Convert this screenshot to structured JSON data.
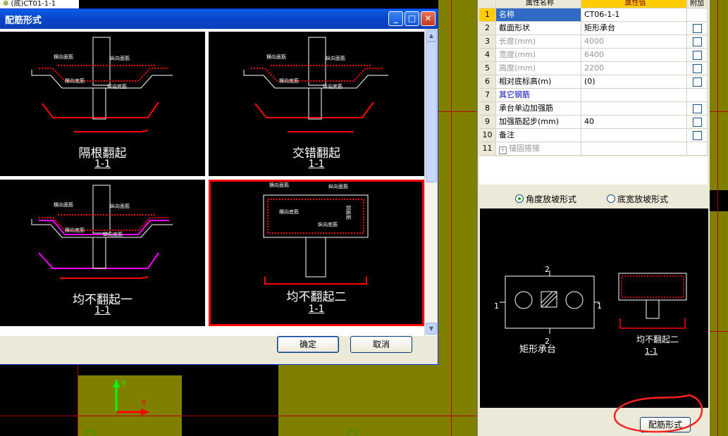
{
  "tree": {
    "item": "(底)CT01-1-1"
  },
  "dialog": {
    "title": "配筋形式",
    "ok_label": "确定",
    "cancel_label": "取消",
    "tiles": [
      {
        "label": "隔根翻起",
        "section": "1-1"
      },
      {
        "label": "交错翻起",
        "section": "1-1"
      },
      {
        "label": "均不翻起一",
        "section": "1-1"
      },
      {
        "label": "均不翻起二",
        "section": "1-1"
      }
    ],
    "annotations": {
      "top_transverse": "横向面筋",
      "top_longitudinal": "纵向面筋",
      "bottom_transverse": "横向底筋",
      "bottom_longitudinal": "纵向底筋",
      "side": "侧面筋"
    }
  },
  "properties": {
    "header": {
      "name": "属性名称",
      "value": "属性值",
      "attach": "附加"
    },
    "rows": [
      {
        "no": "1",
        "name": "名称",
        "value": "CT06-1-1"
      },
      {
        "no": "2",
        "name": "截面形状",
        "value": "矩形承台"
      },
      {
        "no": "3",
        "name": "长度(mm)",
        "value": "4000"
      },
      {
        "no": "4",
        "name": "宽度(mm)",
        "value": "6400"
      },
      {
        "no": "5",
        "name": "高度(mm)",
        "value": "2200"
      },
      {
        "no": "6",
        "name": "相对底标高(m)",
        "value": "(0)"
      },
      {
        "no": "7",
        "name": "其它钢筋",
        "value": ""
      },
      {
        "no": "8",
        "name": "承台单边加强筋",
        "value": ""
      },
      {
        "no": "9",
        "name": "加强筋起步(mm)",
        "value": "40"
      },
      {
        "no": "10",
        "name": "备注",
        "value": ""
      },
      {
        "no": "11",
        "name": "锚固搭接",
        "value": ""
      }
    ]
  },
  "slope_options": {
    "angle": "角度放坡形式",
    "width": "底宽放坡形式"
  },
  "preview": {
    "plan_label": "矩形承台",
    "section_label": "均不翻起二",
    "section_mark": "1-1",
    "num1": "1",
    "num2": "2"
  },
  "reinforcement_button": "配筋形式",
  "axis": {
    "y": "Y",
    "x": "X"
  },
  "colors": {
    "accent": "#ff0000",
    "title_bar": "#0a5fe6",
    "cad_olive": "#808000",
    "selected_value_header": "#ffcc00"
  }
}
